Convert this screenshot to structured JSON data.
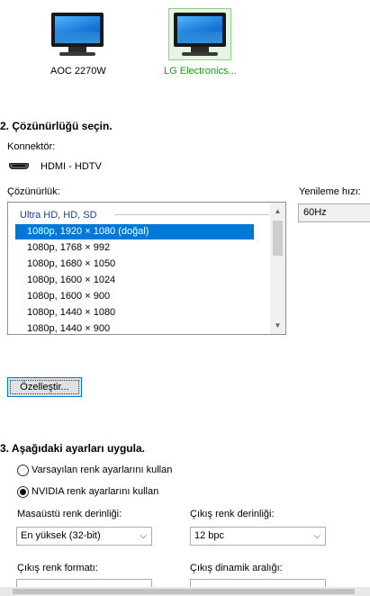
{
  "monitors": [
    {
      "name": "AOC 2270W",
      "selected": false
    },
    {
      "name": "LG Electronics...",
      "selected": true
    }
  ],
  "resolution_section": {
    "title": "2. Çözünürlüğü seçin.",
    "connector_label": "Konnektör:",
    "connector_value": "HDMI - HDTV",
    "resolution_label": "Çözünürlük:",
    "refresh_label": "Yenileme hızı:",
    "refresh_value": "60Hz",
    "group_header": "Ultra HD, HD, SD",
    "items": [
      "1080p, 1920 × 1080 (doğal)",
      "1080p, 1768 × 992",
      "1080p, 1680 × 1050",
      "1080p, 1600 × 1024",
      "1080p, 1600 × 900",
      "1080p, 1440 × 1080",
      "1080p, 1440 × 900"
    ],
    "selected_index": 0,
    "customize_button": "Özelleştir..."
  },
  "apply_section": {
    "title": "3. Aşağıdaki ayarları uygula.",
    "radio_default": "Varsayılan renk ayarlarını kullan",
    "radio_nvidia": "NVIDIA renk ayarlarını kullan",
    "selected_radio": "nvidia",
    "desktop_depth_label": "Masaüstü renk derinliği:",
    "desktop_depth_value": "En yüksek (32-bit)",
    "output_depth_label": "Çıkış renk derinliği:",
    "output_depth_value": "12 bpc",
    "output_format_label": "Çıkış renk formatı:",
    "output_range_label": "Çıkış dinamik aralığı:"
  },
  "colors": {
    "accent": "#0078d7",
    "selected_monitor_bg": "#e6f4e2",
    "group_header": "#1f3d9c"
  }
}
